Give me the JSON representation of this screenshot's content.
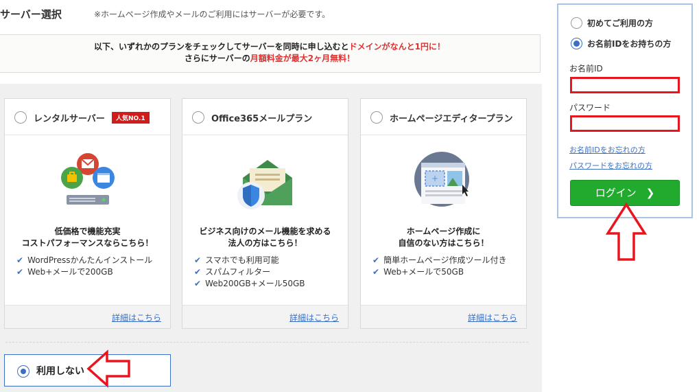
{
  "header": {
    "title": "サーバー選択",
    "note": "※ホームページ作成やメールのご利用にはサーバーが必要です。"
  },
  "promo": {
    "line1_pre": "以下、いずれかのプランをチェックしてサーバーを同時に申し込むと",
    "line1_red": "ドメインがなんと1円に！",
    "line2_pre": "さらにサーバーの",
    "line2_red": "月額料金が最大2ヶ月無料！"
  },
  "plans": [
    {
      "name": "レンタルサーバー",
      "badge": "人気NO.1",
      "lead1": "低価格で機能充実",
      "lead2": "コストパフォーマンスならこちら！",
      "features": [
        "WordPressかんたんインストール",
        "Web+メールで200GB"
      ],
      "detail": "詳細はこちら",
      "icon": "server-icon"
    },
    {
      "name": "Office365メールプラン",
      "lead1": "ビジネス向けのメール機能を求める",
      "lead2": "法人の方はこちら！",
      "features": [
        "スマホでも利用可能",
        "スパムフィルター",
        "Web200GB+メール50GB"
      ],
      "detail": "詳細はこちら",
      "icon": "mail-shield-icon"
    },
    {
      "name": "ホームページエディタープラン",
      "lead1": "ホームページ作成に",
      "lead2": "自信のない方はこちら！",
      "features": [
        "簡単ホームページ作成ツール付き",
        "Web+メールで50GB"
      ],
      "detail": "詳細はこちら",
      "icon": "web-editor-icon"
    }
  ],
  "no_use": {
    "label": "利用しない",
    "selected": true
  },
  "login": {
    "option_new": "初めてご利用の方",
    "option_existing": "お名前IDをお持ちの方",
    "selected": "existing",
    "id_label": "お名前ID",
    "id_value": "",
    "password_label": "パスワード",
    "password_value": "",
    "forgot_id": "お名前IDをお忘れの方",
    "forgot_password": "パスワードをお忘れの方",
    "login_button": "ログイン",
    "button_color": "#22aa2e"
  },
  "annotations": {
    "arrow_color": "#e8141e"
  }
}
